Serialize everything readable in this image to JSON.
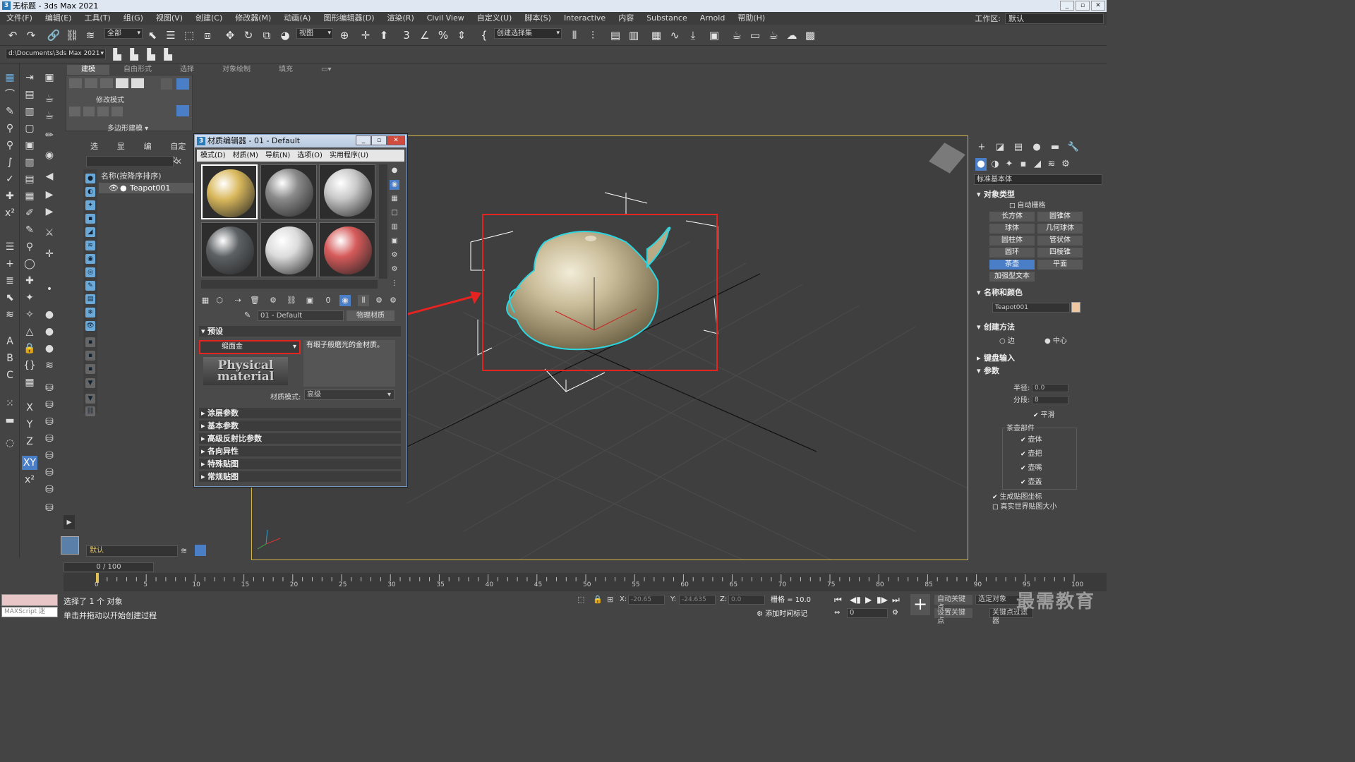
{
  "window": {
    "title": "无标题 - 3ds Max 2021",
    "logo": "3"
  },
  "menu": [
    "文件(F)",
    "编辑(E)",
    "工具(T)",
    "组(G)",
    "视图(V)",
    "创建(C)",
    "修改器(M)",
    "动画(A)",
    "图形编辑器(D)",
    "渲染(R)",
    "Civil View",
    "自定义(U)",
    "脚本(S)",
    "Interactive",
    "内容",
    "Substance",
    "Arnold",
    "帮助(H)"
  ],
  "workspace": {
    "label": "工作区:",
    "value": "默认"
  },
  "toolbar": {
    "filter": "全部",
    "ref_coord": "视图",
    "named_selection": "创建选择集"
  },
  "toolbar2": {
    "path": "d:\\Documents\\3ds Max 2021"
  },
  "ribbon": {
    "tabs": [
      "建模",
      "自由形式",
      "选择",
      "对象绘制",
      "填充"
    ],
    "panel_label": "修改模式",
    "panel_footer": "多边形建模"
  },
  "scene_explorer": {
    "tabs": [
      "选择",
      "显示",
      "编辑",
      "自定义"
    ],
    "header": "名称(按降序排序)",
    "row": "Teapot001",
    "layer": "默认"
  },
  "material_editor": {
    "title": "材质编辑器 - 01 - Default",
    "title_icon": "3",
    "menu": [
      "模式(D)",
      "材质(M)",
      "导航(N)",
      "选项(O)",
      "实用程序(U)"
    ],
    "name": "01 - Default",
    "type_button": "物理材质",
    "rollouts_open": [
      "预设"
    ],
    "preset_value": "缎面金",
    "preset_desc": "有缎子般磨光的金材质。",
    "logo_text_1": "Physical",
    "logo_text_2": "material",
    "mode_label": "材质模式:",
    "mode_value": "高级",
    "rollouts": [
      "涂层参数",
      "基本参数",
      "高级反射比参数",
      "各向异性",
      "特殊贴图",
      "常规贴图"
    ],
    "slot_colors": [
      "#d9b85c",
      "#8a8a8a",
      "#c9c9c9",
      "#5d6164",
      "#dcdcdc",
      "#d65a5a"
    ]
  },
  "command_panel": {
    "dropdown": "标准基本体",
    "object_type": "对象类型",
    "autogrid": "自动栅格",
    "buttons": [
      "长方体",
      "圆锥体",
      "球体",
      "几何球体",
      "圆柱体",
      "管状体",
      "圆环",
      "四棱锥",
      "茶壶",
      "平面",
      "加强型文本"
    ],
    "active_button": "茶壶",
    "name_color": "名称和颜色",
    "object_name": "Teapot001",
    "object_color": "#f0c8a0",
    "creation_method": "创建方法",
    "edge": "边",
    "center": "中心",
    "keyboard_entry": "键盘输入",
    "params": "参数",
    "radius_label": "半径:",
    "radius": "0.0",
    "segments_label": "分段:",
    "segments": "8",
    "smooth": "平滑",
    "teapot_parts": "茶壶部件",
    "parts": [
      "壶体",
      "壶把",
      "壶嘴",
      "壶盖"
    ],
    "gen_mapping": "生成贴图坐标",
    "real_world": "真实世界贴图大小"
  },
  "timeline": {
    "slider": "0 / 100",
    "ticks": [
      "0",
      "5",
      "10",
      "15",
      "20",
      "25",
      "30",
      "35",
      "40",
      "45",
      "50",
      "55",
      "60",
      "65",
      "70",
      "75",
      "80",
      "85",
      "90",
      "95",
      "100"
    ]
  },
  "status": {
    "maxscript": "MAXScript 迷",
    "line1": "选择了 1 个 对象",
    "line2": "单击并拖动以开始创建过程",
    "x_label": "X:",
    "x": "-20.65",
    "y_label": "Y:",
    "y": "-24.635",
    "z_label": "Z:",
    "z": "0.0",
    "grid": "栅格 = 10.0",
    "add_time_tag": "添加时间标记",
    "auto_key": "自动关键点",
    "set_key": "设置关键点",
    "selected": "选定对象",
    "key_filter": "关键点过滤器",
    "frame": "0"
  },
  "watermark": "最需教育",
  "accent": {
    "highlight": "#e52320",
    "active": "#4a7ec7",
    "viewport_border": "#d2b64a"
  }
}
